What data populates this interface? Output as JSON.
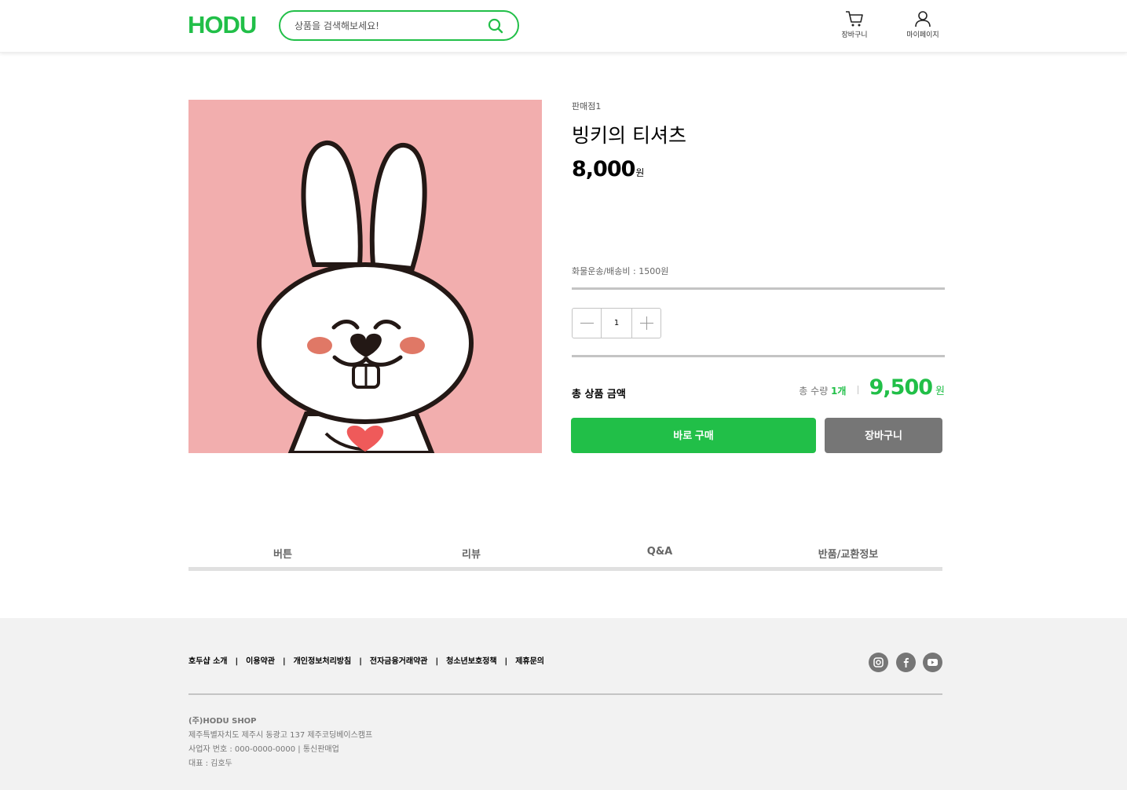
{
  "header": {
    "logo": "HODU",
    "search_placeholder": "상품을 검색해보세요!",
    "cart_label": "장바구니",
    "mypage_label": "마이페이지"
  },
  "product": {
    "seller": "판매점1",
    "name": "빙키의 티셔츠",
    "price": "8,000",
    "price_unit": "원",
    "shipping": "화물운송/배송비 : 1500원",
    "quantity": "1",
    "total_label": "총 상품 금액",
    "total_count_prefix": "총 수량 ",
    "total_count": "1개",
    "total_amount": "9,500",
    "total_unit": "원",
    "buy_now": "바로 구매",
    "add_cart": "장바구니"
  },
  "tabs": [
    "버튼",
    "리뷰",
    "Q&A",
    "반품/교환정보"
  ],
  "footer": {
    "links": [
      "호두샵 소개",
      "이용약관",
      "개인정보처리방침",
      "전자금융거래약관",
      "청소년보호정책",
      "제휴문의"
    ],
    "company": "(주)HODU SHOP",
    "address": "제주특별자치도 제주시 동광고 137 제주코딩베이스캠프",
    "business_no": "사업자 번호 : 000-0000-0000 | 통신판매업",
    "ceo": "대표 : 김호두"
  },
  "colors": {
    "accent": "#21bf48",
    "gray_button": "#767676",
    "image_bg": "#f2aeae",
    "footer_bg": "#f2f2f2"
  }
}
